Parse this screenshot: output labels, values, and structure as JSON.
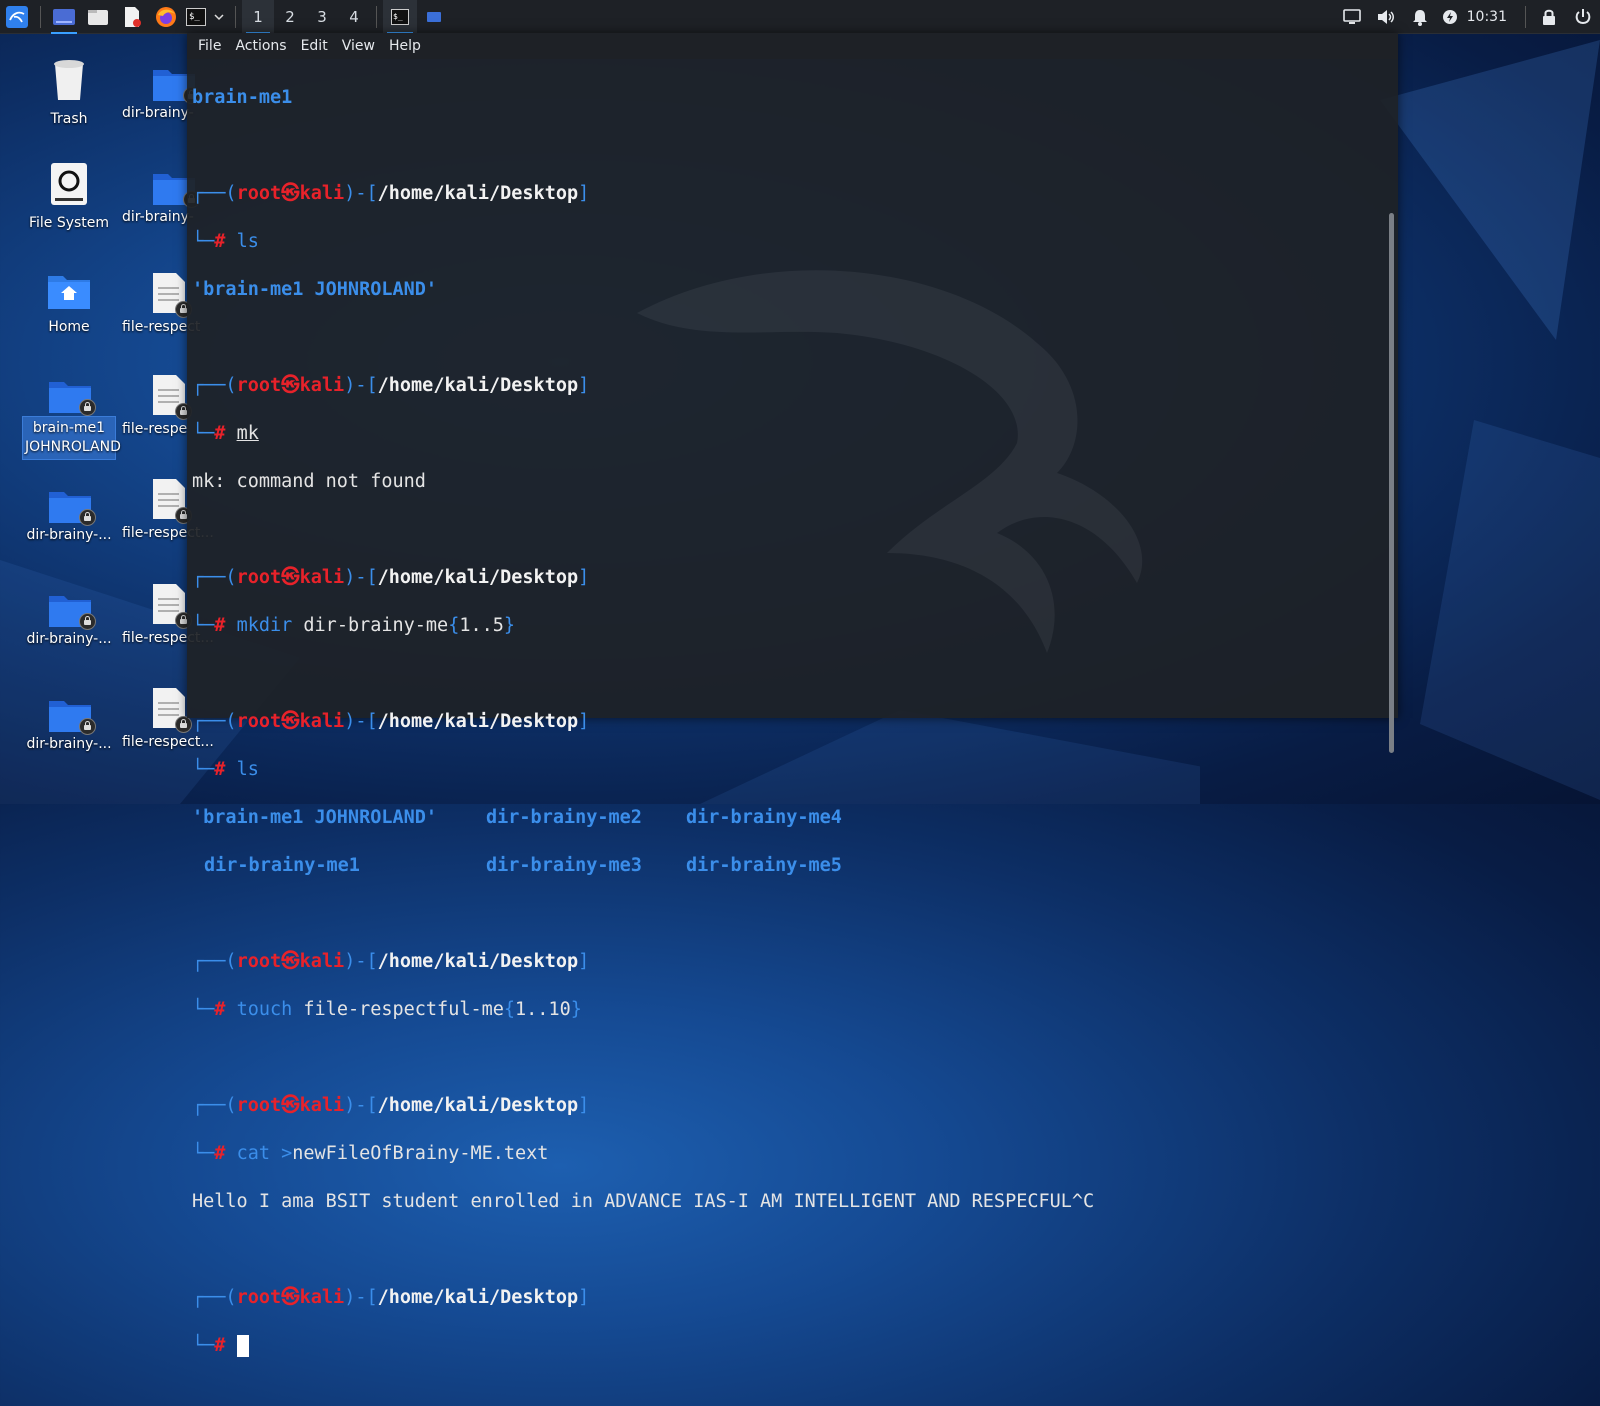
{
  "panel": {
    "workspaces": [
      "1",
      "2",
      "3",
      "4"
    ],
    "clock": "10:31",
    "colors": {
      "accent": "#3aa0ff",
      "background": "#1e2126"
    }
  },
  "desktop": {
    "icons": [
      {
        "label": "Trash",
        "icon": "trash-icon"
      },
      {
        "label": "File System",
        "icon": "drive-icon"
      },
      {
        "label": "Home",
        "icon": "home-folder-icon"
      },
      {
        "label": "brain-me1 JOHNROLAND",
        "icon": "folder-icon",
        "selected": true
      },
      {
        "label": "dir-brainy-...",
        "icon": "folder-icon"
      },
      {
        "label": "dir-brainy-...",
        "icon": "folder-icon"
      },
      {
        "label": "dir-brainy-...",
        "icon": "folder-icon"
      },
      {
        "label": "dir-brainy-",
        "icon": "folder-icon"
      },
      {
        "label": "dir-brainy-",
        "icon": "folder-icon"
      },
      {
        "label": "file-respect",
        "icon": "file-icon"
      },
      {
        "label": "file-respe",
        "icon": "file-icon"
      },
      {
        "label": "file-respect...",
        "icon": "file-icon"
      },
      {
        "label": "file-respect...",
        "icon": "file-icon"
      },
      {
        "label": "file-respect...",
        "icon": "file-icon"
      }
    ]
  },
  "terminal": {
    "menu": [
      "File",
      "Actions",
      "Edit",
      "View",
      "Help"
    ],
    "prompt": {
      "user": "root",
      "host": "kali",
      "path": "/home/kali/Desktop",
      "symbol": "#"
    },
    "top_line": "brain-me1",
    "cmd1": "ls",
    "out1": "'brain-me1 JOHNROLAND'",
    "cmd2": "mk",
    "out2": "mk: command not found",
    "cmd3_word": "mkdir",
    "cmd3_arg": "dir-brainy-me",
    "cmd3_brace": "1..5",
    "cmd4": "ls",
    "out4_row1": [
      "'brain-me1 JOHNROLAND'",
      "dir-brainy-me2",
      "dir-brainy-me4"
    ],
    "out4_row2": [
      "dir-brainy-me1",
      "dir-brainy-me3",
      "dir-brainy-me5"
    ],
    "cmd5_word": "touch",
    "cmd5_arg": "file-respectful-me",
    "cmd5_brace": "1..10",
    "cmd6_word": "cat",
    "cmd6_redir": ">",
    "cmd6_arg": "newFileOfBrainy-ME.text",
    "out6": "Hello I ama BSIT student enrolled in ADVANCE IAS-I AM INTELLIGENT AND RESPECFUL^C"
  }
}
